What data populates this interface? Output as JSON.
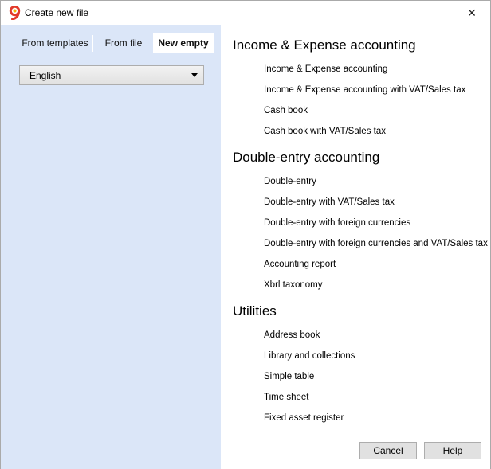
{
  "window": {
    "title": "Create new file",
    "close_glyph": "✕"
  },
  "tabs": [
    {
      "label": "From templates",
      "active": false
    },
    {
      "label": "From file",
      "active": false
    },
    {
      "label": "New empty",
      "active": true
    }
  ],
  "language_select": {
    "value": "English"
  },
  "sections": [
    {
      "title": "Income & Expense accounting",
      "items": [
        "Income & Expense accounting",
        "Income & Expense accounting with VAT/Sales tax",
        "Cash book",
        "Cash book with VAT/Sales tax"
      ]
    },
    {
      "title": "Double-entry accounting",
      "items": [
        "Double-entry",
        "Double-entry with VAT/Sales tax",
        "Double-entry with foreign currencies",
        "Double-entry with foreign currencies and VAT/Sales tax",
        "Accounting report",
        "Xbrl taxonomy"
      ]
    },
    {
      "title": "Utilities",
      "items": [
        "Address book",
        "Library and collections",
        "Simple table",
        "Time sheet",
        "Fixed asset register"
      ]
    }
  ],
  "buttons": {
    "cancel": "Cancel",
    "help": "Help"
  },
  "colors": {
    "left_pane_bg": "#dbe6f8",
    "app_icon_red": "#e23a2a",
    "app_icon_yellow": "#f5b400"
  },
  "icons": {
    "app": "banana-logo-icon",
    "close": "close-icon",
    "dropdown": "chevron-down-icon"
  }
}
